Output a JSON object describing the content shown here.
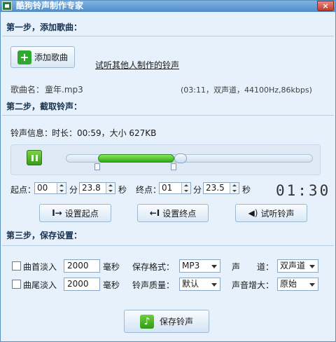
{
  "window": {
    "title": "酷狗铃声制作专家",
    "close": "×"
  },
  "step1": {
    "heading": "第一步，添加歌曲：",
    "add_song_label": "添加歌曲",
    "listen_others_link": "试听其他人制作的铃声",
    "song_name_label": "歌曲名：",
    "song_name_value": "童年.mp3",
    "song_info": "(03:11，双声道，44100Hz,86kbps)"
  },
  "step2": {
    "heading": "第二步，截取铃声：",
    "ringtone_info_label": "铃声信息：",
    "ringtone_info_value": "时长：00:59，大小 627KB",
    "start_label": "起点：",
    "start_min": "00",
    "min_unit": "分",
    "start_sec": "23.8",
    "sec_unit": "秒",
    "end_label": "终点：",
    "end_min": "01",
    "end_sec": "23.5",
    "clock": "01:30",
    "set_start_label": "设置起点",
    "set_end_label": "设置终点",
    "preview_label": "试听铃声"
  },
  "step3": {
    "heading": "第三步，保存设置：",
    "fade_in_label": "曲首淡入",
    "fade_in_value": "2000",
    "fade_out_label": "曲尾淡入",
    "fade_out_value": "2000",
    "ms_unit": "毫秒",
    "format_label": "保存格式：",
    "format_value": "MP3",
    "quality_label": "铃声质量：",
    "quality_value": "默认",
    "channel_label": "声　　道：",
    "channel_value": "双声道",
    "volume_label": "声音增大：",
    "volume_value": "原始",
    "save_label": "保存铃声"
  }
}
